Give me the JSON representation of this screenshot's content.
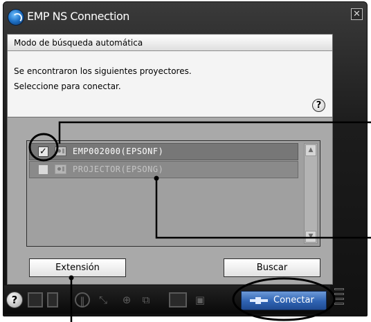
{
  "window": {
    "title": "EMP NS Connection",
    "close_icon": "close-icon",
    "close_glyph": "✕"
  },
  "mode_bar": {
    "label": "Modo de búsqueda automática"
  },
  "info": {
    "line1": "Se encontraron los siguientes proyectores.",
    "line2": "Seleccione para conectar.",
    "help_glyph": "?"
  },
  "projectors": [
    {
      "name": "EMP002000(EPSONF)",
      "checked": true,
      "check_glyph": "✓"
    },
    {
      "name": "PROJECTOR(EPSONG)",
      "checked": false,
      "check_glyph": ""
    }
  ],
  "buttons": {
    "extension": "Extensión",
    "search": "Buscar",
    "connect": "Conectar"
  },
  "toolbar": {
    "help_glyph": "?",
    "icons": [
      "help-icon",
      "monitor-icon",
      "document-icon",
      "pause-icon",
      "disconnect-icon",
      "zoom-icon",
      "multi-screen-icon",
      "video-icon",
      "camera-icon",
      "connect-icon",
      "menu-icon"
    ]
  },
  "colors": {
    "window_bg": "#1c1c1c",
    "client_bg": "#a9a9a9",
    "selected_row": "#777777",
    "connect_accent": "#2f63b2",
    "annotation": "#000000"
  }
}
